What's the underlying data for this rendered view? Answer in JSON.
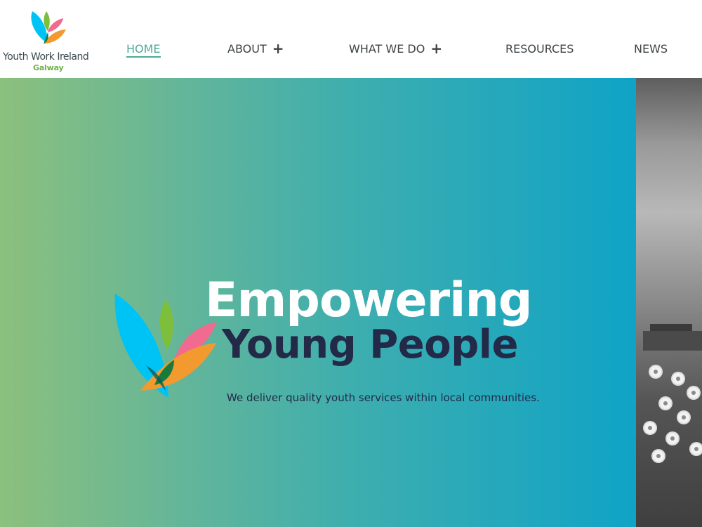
{
  "brand": {
    "line1": "Youth Work Ireland",
    "line2": "Galway",
    "logo_icon": "leaf-petals-logo"
  },
  "nav": {
    "items": [
      {
        "label": "HOME",
        "active": true,
        "has_submenu": false
      },
      {
        "label": "ABOUT",
        "active": false,
        "has_submenu": true
      },
      {
        "label": "WHAT WE DO",
        "active": false,
        "has_submenu": true
      },
      {
        "label": "RESOURCES",
        "active": false,
        "has_submenu": false
      },
      {
        "label": "NEWS",
        "active": false,
        "has_submenu": false
      }
    ],
    "submenu_icon": "plus-icon",
    "active_color": "#4ea99a",
    "text_color": "#3d4246"
  },
  "hero": {
    "title_line1": "Empowering",
    "title_line2": "Young People",
    "subtitle": "We deliver quality youth services within local communities.",
    "title_line1_color": "#ffffff",
    "title_line2_color": "#232a48",
    "gradient_start": "#8cc07e",
    "gradient_end": "#0fa3c7"
  }
}
